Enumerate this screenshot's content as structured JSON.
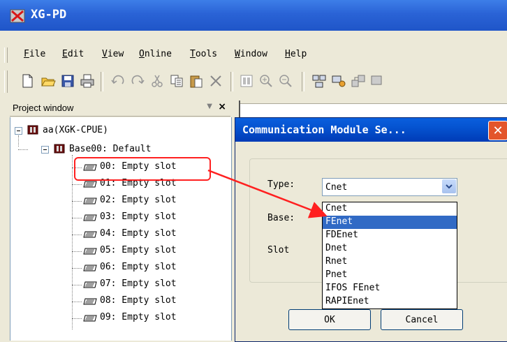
{
  "app": {
    "title": "XG-PD"
  },
  "menu": [
    {
      "label": "File",
      "u": "F"
    },
    {
      "label": "Edit",
      "u": "E"
    },
    {
      "label": "View",
      "u": "V"
    },
    {
      "label": "Online",
      "u": "O"
    },
    {
      "label": "Tools",
      "u": "T"
    },
    {
      "label": "Window",
      "u": "W"
    },
    {
      "label": "Help",
      "u": "H"
    }
  ],
  "project_window": {
    "title": "Project window",
    "root": "aa(XGK-CPUE)",
    "base": "Base00: Default",
    "slots": [
      "00: Empty slot",
      "01: Empty slot",
      "02: Empty slot",
      "03: Empty slot",
      "04: Empty slot",
      "05: Empty slot",
      "06: Empty slot",
      "07: Empty slot",
      "08: Empty slot",
      "09: Empty slot"
    ]
  },
  "dialog": {
    "title": "Communication Module Se...",
    "type_label": "Type:",
    "base_label": "Base:",
    "slot_label": "Slot",
    "type_value": "Cnet",
    "options": [
      "Cnet",
      "FEnet",
      "FDEnet",
      "Dnet",
      "Rnet",
      "Pnet",
      "IFOS FEnet",
      "RAPIEnet"
    ],
    "selected_index": 1,
    "ok_label": "OK",
    "cancel_label": "Cancel"
  },
  "colors": {
    "accent": "#316ac5",
    "annotation": "#ff2020",
    "titlebar": "#2a63d6"
  }
}
